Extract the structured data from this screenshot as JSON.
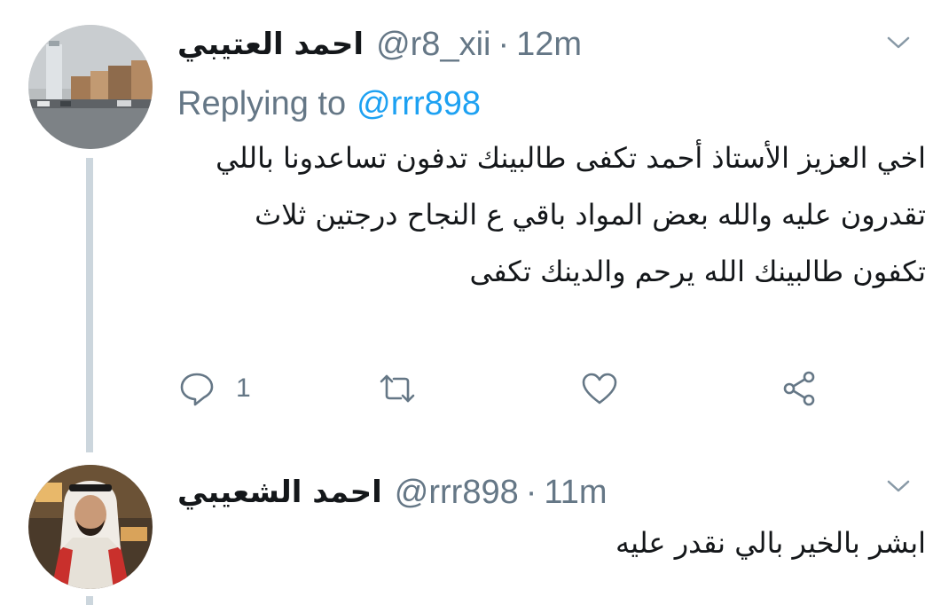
{
  "tweets": [
    {
      "display_name": "احمد العتيبي",
      "handle": "@r8_xii",
      "separator": "·",
      "time": "12m",
      "replying_prefix": "Replying to",
      "replying_to": "@rrr898",
      "text": "اخي العزيز الأستاذ أحمد تكفى طالبينك تدفون تساعدونا باللي تقدرون عليه والله بعض المواد باقي ع النجاح درجتين ثلاث تكفون طالبينك الله يرحم والدينك تكفى",
      "reply_count": "1",
      "icons": [
        "reply-icon",
        "retweet-icon",
        "like-icon",
        "share-icon",
        "caret-down-icon"
      ]
    },
    {
      "display_name": "احمد الشعيبي",
      "handle": "@rrr898",
      "separator": "·",
      "time": "11m",
      "text": "ابشر بالخير بالي نقدر عليه",
      "icons": [
        "caret-down-icon"
      ]
    }
  ],
  "colors": {
    "secondary_text": "#657786",
    "link": "#1da1f2",
    "thread_line": "#ccd6dd",
    "primary_text": "#14171a"
  }
}
